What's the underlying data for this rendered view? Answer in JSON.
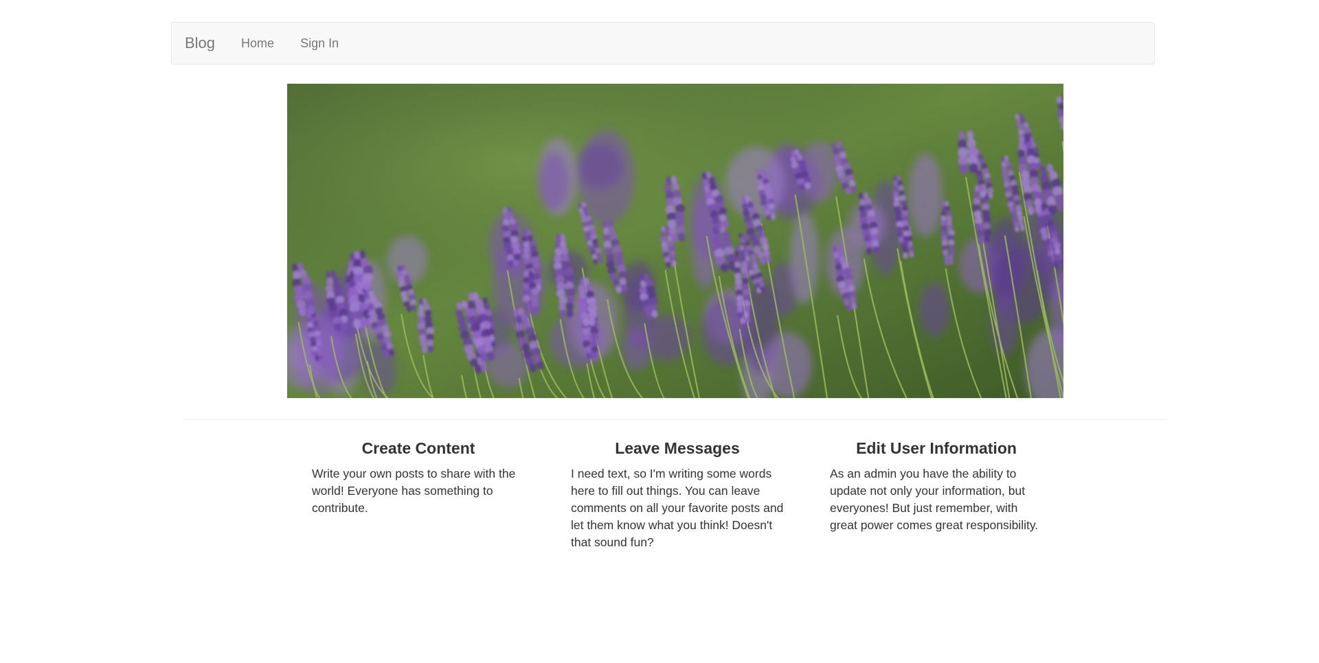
{
  "navbar": {
    "brand": "Blog",
    "links": [
      {
        "label": "Home"
      },
      {
        "label": "Sign In"
      }
    ]
  },
  "hero": {
    "image": "lavender-field-photo"
  },
  "features": [
    {
      "title": "Create Content",
      "text": "Write your own posts to share with the world! Everyone has something to contribute."
    },
    {
      "title": "Leave Messages",
      "text": "I need text, so I'm writing some words here to fill out things. You can leave comments on all your favorite posts and let them know what you think! Doesn't that sound fun?"
    },
    {
      "title": "Edit User Information",
      "text": "As an admin you have the ability to update not only your information, but everyones! But just remember, with great power comes great responsibility."
    }
  ],
  "colors": {
    "navbar_bg": "#f8f8f8",
    "navbar_border": "#e7e7e7",
    "nav_text": "#777777",
    "body_text": "#333333"
  }
}
